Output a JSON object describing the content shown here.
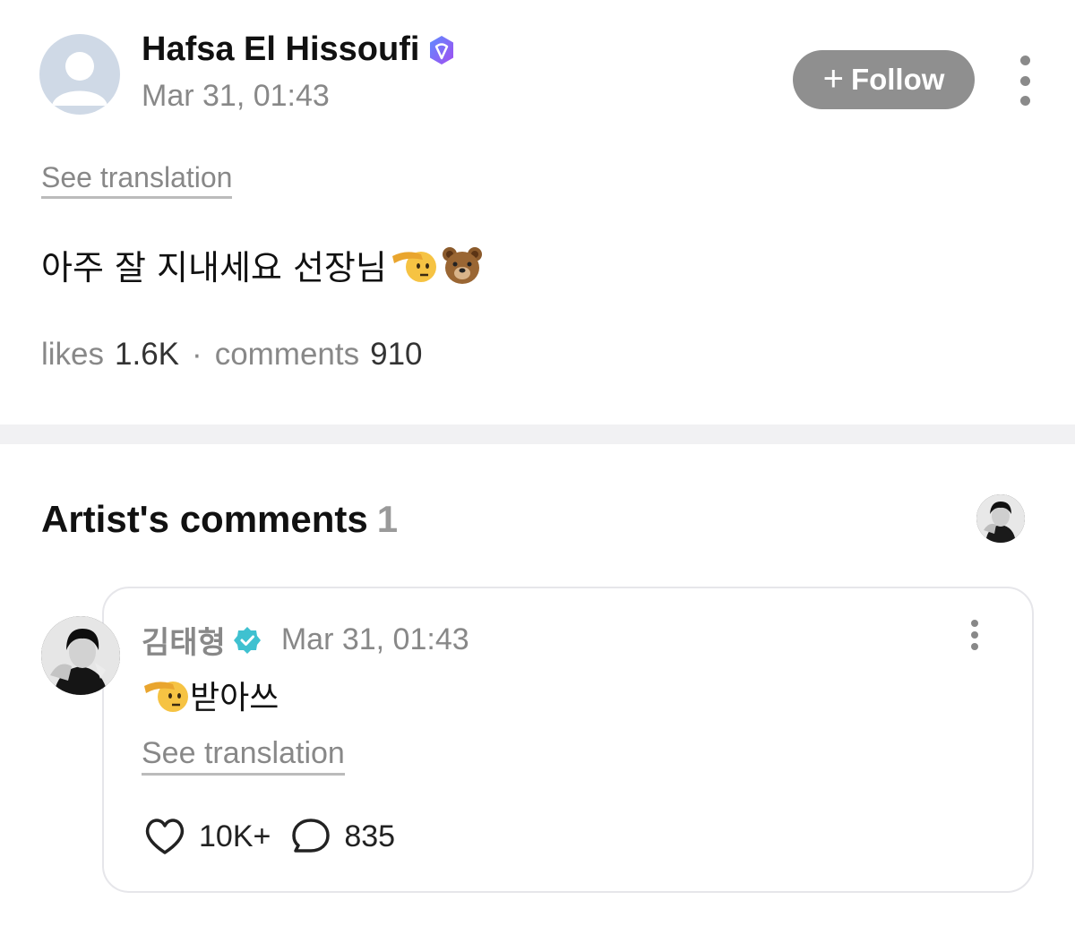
{
  "post": {
    "author_name": "Hafsa El Hissoufi",
    "timestamp": "Mar 31, 01:43",
    "follow_label": "Follow",
    "see_translation": "See translation",
    "body_text": "아주 잘 지내세요 선장님",
    "body_emojis": [
      "saluting-face",
      "bear-face"
    ],
    "likes_label": "likes",
    "likes_count": "1.6K",
    "separator": "·",
    "comments_label": "comments",
    "comments_count": "910",
    "verified_badge_color": "#7b5cf5"
  },
  "artist_comments": {
    "title": "Artist's comments",
    "count": "1"
  },
  "comment": {
    "author_name": "김태형",
    "timestamp": "Mar 31, 01:43",
    "body_text": "받아쓰",
    "body_emoji": "saluting-face",
    "see_translation": "See translation",
    "likes_count": "10K+",
    "replies_count": "835",
    "verified_badge_color": "#3fc1d0"
  },
  "colors": {
    "follow_button_bg": "#8f8f8f",
    "muted_text": "#888888",
    "divider": "#f1f1f3"
  }
}
